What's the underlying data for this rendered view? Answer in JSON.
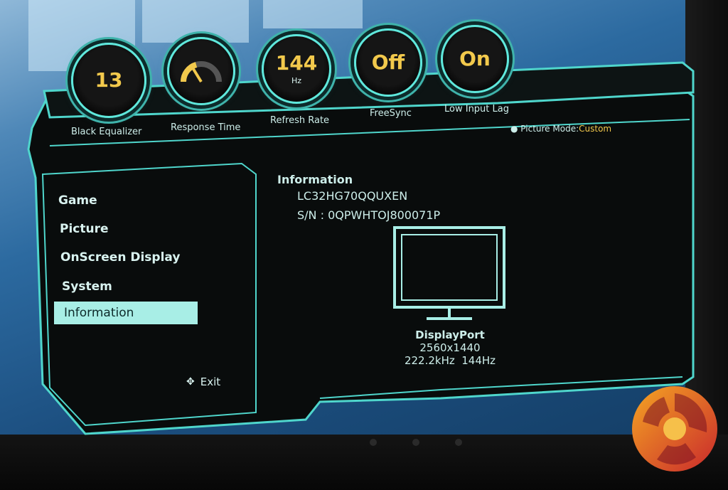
{
  "status_knobs": [
    {
      "value": "13",
      "unit": "",
      "label": "Black Equalizer"
    },
    {
      "value": "",
      "unit": "",
      "label": "Response Time",
      "gauge": "fast"
    },
    {
      "value": "144",
      "unit": "Hz",
      "label": "Refresh Rate"
    },
    {
      "value": "Off",
      "unit": "",
      "label": "FreeSync"
    },
    {
      "value": "On",
      "unit": "",
      "label": "Low Input Lag"
    }
  ],
  "picture_mode": {
    "label": "Picture Mode:",
    "value": "Custom"
  },
  "menu": {
    "items": [
      {
        "label": "Game"
      },
      {
        "label": "Picture"
      },
      {
        "label": "OnScreen Display"
      },
      {
        "label": "System"
      },
      {
        "label": "Information",
        "selected": true
      }
    ],
    "exit_label": "Exit"
  },
  "information": {
    "title": "Information",
    "model": "LC32HG70QQUXEN",
    "serial_label": "S/N",
    "serial_value": "0QPWHTOJ800071P",
    "port": "DisplayPort",
    "resolution": "2560x1440",
    "frequency": "222.2kHz  144Hz"
  },
  "colors": {
    "accent": "#5fe8dc",
    "highlight_text": "#f2c94c",
    "selected_bg": "#a8eee6"
  },
  "icons": [
    "gauge-icon",
    "monitor-icon",
    "directional-pad-icon",
    "logo-icon"
  ]
}
